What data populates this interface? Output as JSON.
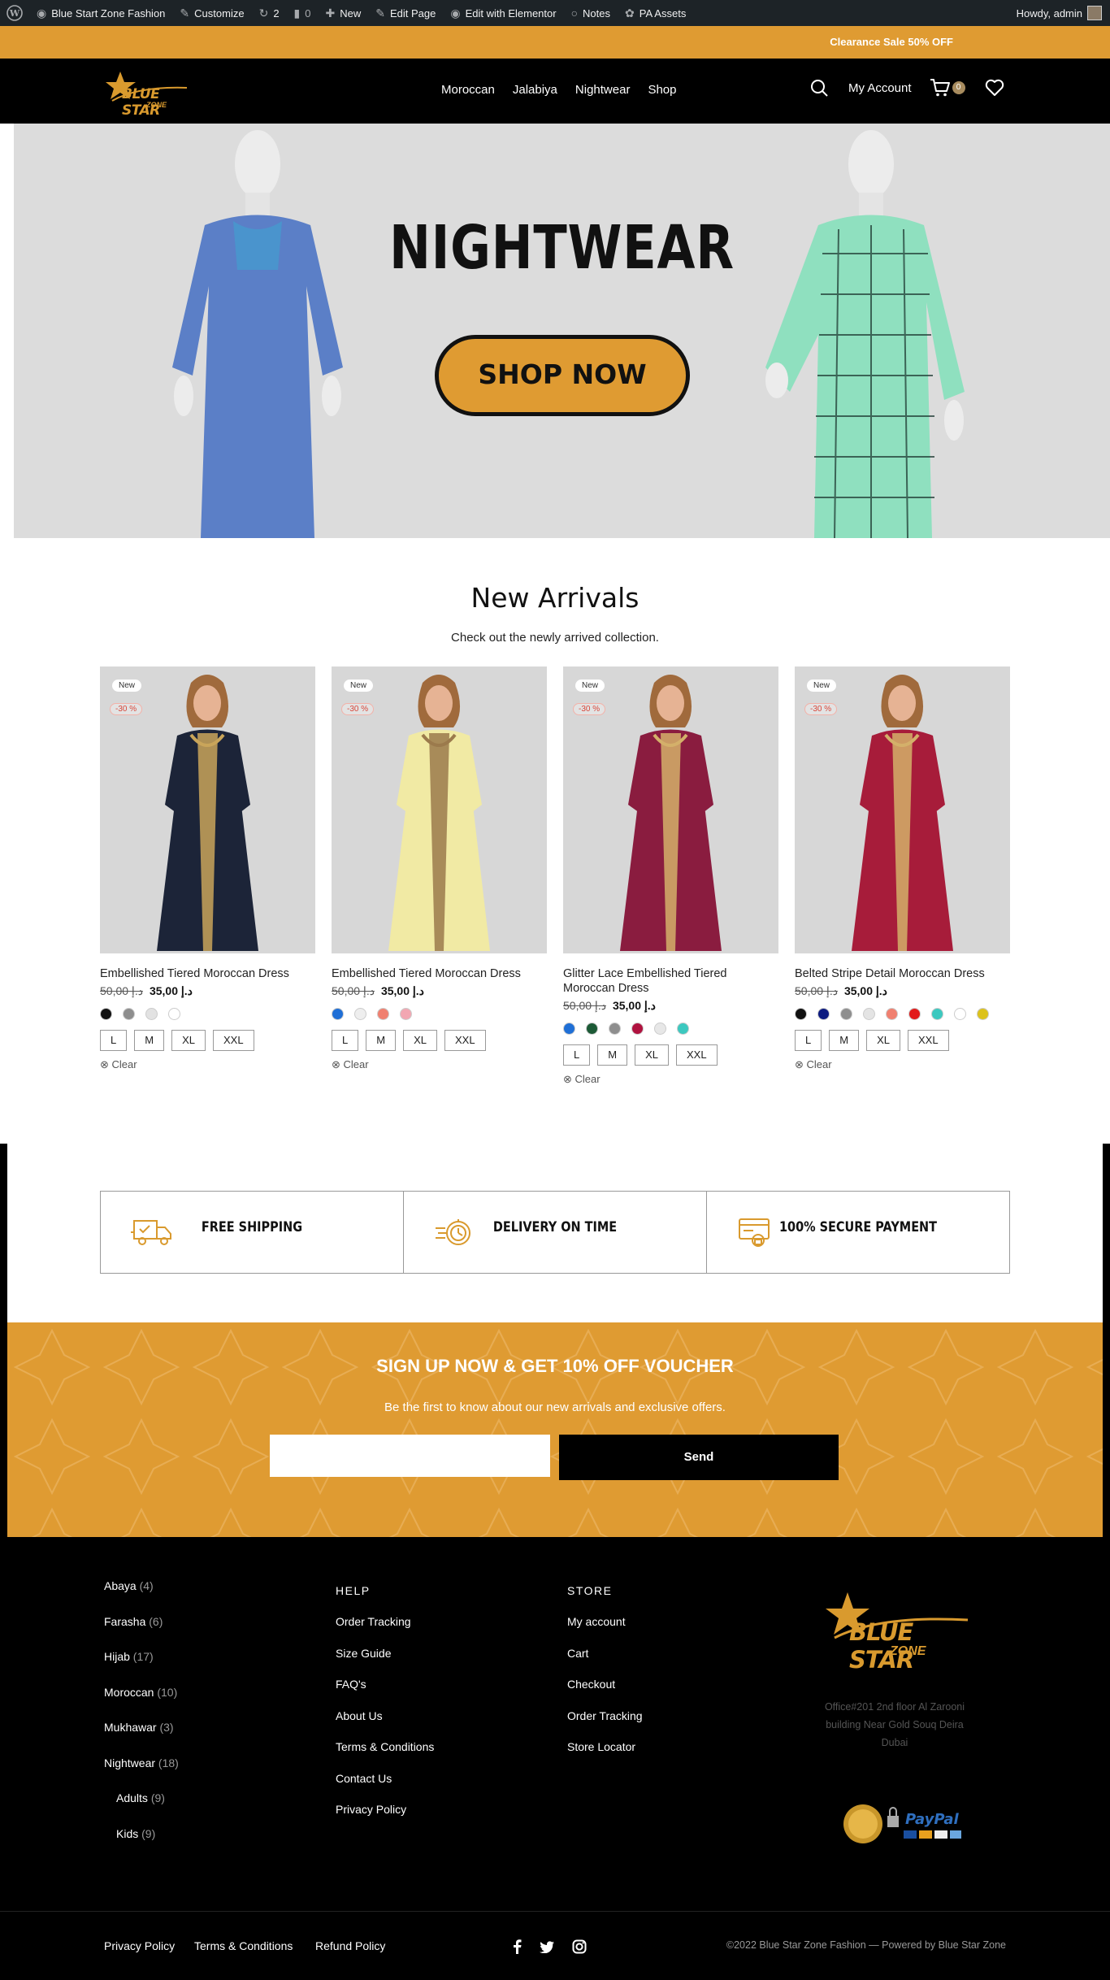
{
  "admin_bar": {
    "site_name": "Blue Start Zone Fashion",
    "customize": "Customize",
    "updates": "2",
    "comments": "0",
    "new": "New",
    "edit_page": "Edit Page",
    "edit_elementor": "Edit with Elementor",
    "notes": "Notes",
    "pa_assets": "PA Assets",
    "howdy": "Howdy, admin"
  },
  "promo_text": "Clearance Sale 50% OFF",
  "header": {
    "logo_text": "BLUE STAR",
    "logo_sub": "ZONE",
    "nav": [
      "Moroccan",
      "Jalabiya",
      "Nightwear",
      "Shop"
    ],
    "account": "My Account",
    "cart_count": "0"
  },
  "hero": {
    "title": "NIGHTWEAR",
    "button": "SHOP NOW"
  },
  "new_arrivals": {
    "title": "New Arrivals",
    "subtitle": "Check out the newly arrived collection.",
    "products": [
      {
        "badge": "New",
        "sale": "-30 %",
        "name": "Embellished Tiered Moroccan Dress",
        "old_price": "د.إ 50,00",
        "price": "د.إ 35,00",
        "colors": [
          "#111111",
          "#8e8e8e",
          "#e2e2e2",
          "#ffffff"
        ],
        "sizes": [
          "L",
          "M",
          "XL",
          "XXL"
        ],
        "clear": "Clear",
        "dress": "#1c2438",
        "trim": "#c9a55a"
      },
      {
        "badge": "New",
        "sale": "-30 %",
        "name": "Embellished Tiered Moroccan Dress",
        "old_price": "د.إ 50,00",
        "price": "د.إ 35,00",
        "colors": [
          "#1f6fd6",
          "#eeeeee",
          "#f08070",
          "#f2a7b2"
        ],
        "sizes": [
          "L",
          "M",
          "XL",
          "XXL"
        ],
        "clear": "Clear",
        "dress": "#f1eaa4",
        "trim": "#9b7a4c"
      },
      {
        "badge": "New",
        "sale": "-30 %",
        "name": "Glitter Lace Embellished Tiered Moroccan Dress",
        "old_price": "د.إ 50,00",
        "price": "د.إ 35,00",
        "colors": [
          "#1f6fd6",
          "#1c5a36",
          "#8e8e8e",
          "#b0123f",
          "#e7e7e7",
          "#3cc8bf"
        ],
        "sizes": [
          "L",
          "M",
          "XL",
          "XXL"
        ],
        "clear": "Clear",
        "dress": "#8a1c3f",
        "trim": "#d4b06a"
      },
      {
        "badge": "New",
        "sale": "-30 %",
        "name": "Belted Stripe Detail Moroccan Dress",
        "old_price": "د.إ 50,00",
        "price": "د.إ 35,00",
        "colors": [
          "#111111",
          "#0d1b80",
          "#8e8e8e",
          "#e4e4e4",
          "#f08070",
          "#e21b1b",
          "#3cc8bf",
          "#ffffff",
          "#dcc21c"
        ],
        "sizes": [
          "L",
          "M",
          "XL",
          "XXL"
        ],
        "clear": "Clear",
        "dress": "#a71c3a",
        "trim": "#d4b06a"
      }
    ]
  },
  "features": [
    "FREE SHIPPING",
    "DELIVERY ON TIME",
    "100% SECURE PAYMENT"
  ],
  "signup": {
    "title": "SIGN UP NOW & GET 10% OFF VOUCHER",
    "subtitle": "Be the first to know about our new arrivals and exclusive offers.",
    "button": "Send"
  },
  "footer": {
    "categories": [
      {
        "name": "Abaya",
        "count": "(4)"
      },
      {
        "name": "Farasha",
        "count": "(6)"
      },
      {
        "name": "Hijab",
        "count": "(17)"
      },
      {
        "name": "Moroccan",
        "count": "(10)"
      },
      {
        "name": "Mukhawar",
        "count": "(3)"
      },
      {
        "name": "Nightwear",
        "count": "(18)"
      },
      {
        "name": "Adults",
        "count": "(9)",
        "sub": true
      },
      {
        "name": "Kids",
        "count": "(9)",
        "sub": true
      }
    ],
    "help_title": "HELP",
    "help_links": [
      "Order Tracking",
      "Size Guide",
      "FAQ's",
      "About Us",
      "Terms & Conditions",
      "Contact Us",
      "Privacy Policy"
    ],
    "store_title": "STORE",
    "store_links": [
      "My account",
      "Cart",
      "Checkout",
      "Order Tracking",
      "Store Locator"
    ],
    "address": "Office#201 2nd floor Al Zarooni building Near Gold Souq Deira Dubai",
    "bottom_links": [
      "Privacy Policy",
      "Terms & Conditions",
      "Refund Policy"
    ],
    "copyright": "©2022 Blue Star Zone Fashion — Powered by Blue Star Zone"
  },
  "colors": {
    "accent": "#df9b32",
    "dark": "#000000",
    "admin_bar": "#1d2327"
  }
}
